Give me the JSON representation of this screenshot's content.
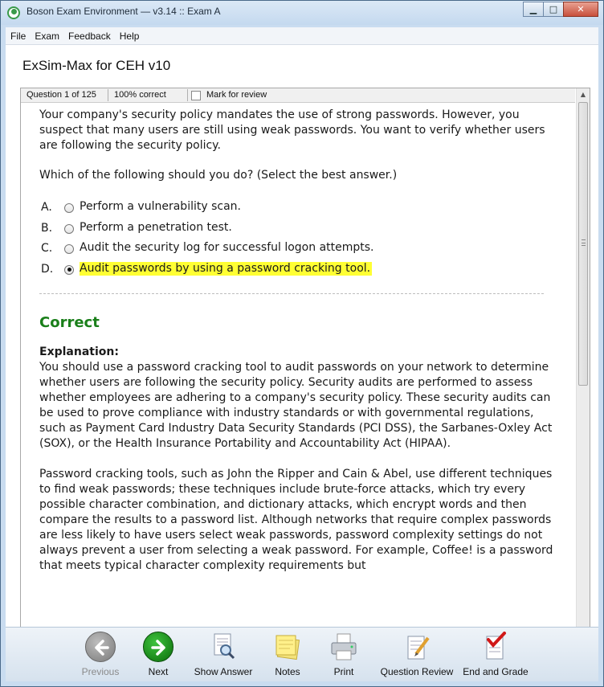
{
  "window": {
    "title": "Boson Exam Environment — v3.14 :: Exam A",
    "controls": {
      "minimize": "▁",
      "maximize": "□",
      "close": "✕"
    }
  },
  "menu": [
    "File",
    "Exam",
    "Feedback",
    "Help"
  ],
  "exam_title": "ExSim-Max for CEH v10",
  "status": {
    "question": "Question 1 of 125",
    "score": "100% correct",
    "mark_review": "Mark for review"
  },
  "question": {
    "text": "Your company's security policy mandates the use of strong passwords. However, you suspect that many users are still using weak passwords. You want to verify whether users are following the security policy.",
    "prompt": "Which of the following should you do?  (Select the best answer.)",
    "choices": [
      {
        "letter": "A.",
        "text": "Perform a vulnerability scan.",
        "selected": false
      },
      {
        "letter": "B.",
        "text": "Perform a penetration test.",
        "selected": false
      },
      {
        "letter": "C.",
        "text": "Audit the security log for successful logon attempts.",
        "selected": false
      },
      {
        "letter": "D.",
        "text": "Audit passwords by using a password cracking tool.",
        "selected": true
      }
    ]
  },
  "result": "Correct",
  "explanation": {
    "heading": "Explanation:",
    "paragraphs": [
      "You should use a password cracking tool to audit passwords on your network to determine whether users are following the security policy. Security audits are performed to assess whether employees are adhering to a company's security policy. These security audits can be used to prove compliance with industry standards or with governmental regulations, such as Payment Card Industry Data Security Standards (PCI DSS), the Sarbanes-Oxley Act (SOX), or the Health Insurance Portability and Accountability Act (HIPAA).",
      "Password cracking tools, such as John the Ripper and Cain & Abel, use different techniques to find weak passwords; these techniques include brute-force attacks, which try every possible character combination, and dictionary attacks, which encrypt words and then compare the results to a password list. Although networks that require complex passwords are less likely to have users select weak passwords, password complexity settings do not always prevent a user from selecting a weak password. For example, Coffee! is a password that meets typical character complexity requirements but"
    ]
  },
  "toolbar": {
    "previous": "Previous",
    "next": "Next",
    "show_answer": "Show Answer",
    "notes": "Notes",
    "print": "Print",
    "question_review": "Question Review",
    "end_and_grade": "End and Grade"
  },
  "colors": {
    "correct": "#1a7f1a",
    "highlight": "#ffff33",
    "next_button": "#1e9a1e"
  }
}
